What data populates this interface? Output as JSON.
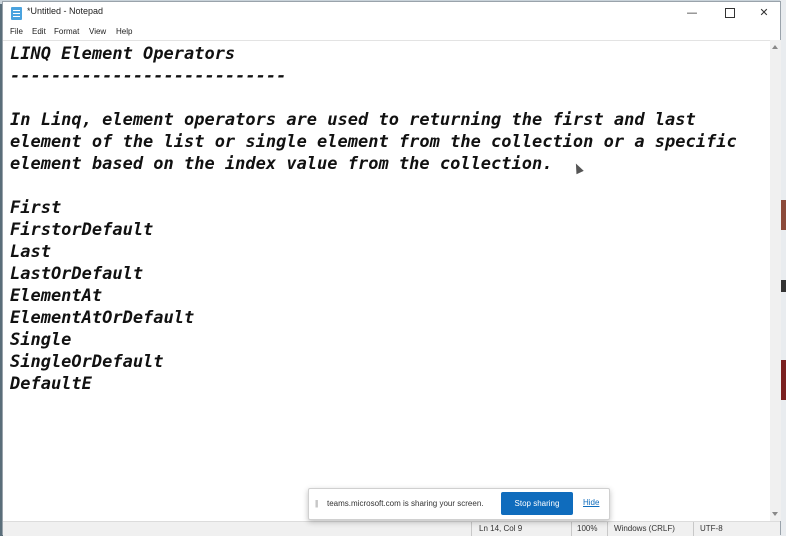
{
  "window": {
    "title": "*Untitled - Notepad",
    "minimize": "—",
    "close": "✕"
  },
  "menu": [
    "File",
    "Edit",
    "Format",
    "View",
    "Help"
  ],
  "document": {
    "lines": [
      "LINQ Element Operators",
      "---------------------------",
      "",
      "In Linq, element operators are used to returning the first and last",
      "element of the list or single element from the collection or a specific",
      "element based on the index value from the collection.",
      "",
      "First",
      "FirstorDefault",
      "Last",
      "LastOrDefault",
      "ElementAt",
      "ElementAtOrDefault",
      "Single",
      "SingleOrDefault",
      "DefaultE"
    ]
  },
  "status": {
    "position": "Ln 14, Col 9",
    "zoom": "100%",
    "line_ending": "Windows (CRLF)",
    "encoding": "UTF-8"
  },
  "share_bar": {
    "message": "teams.microsoft.com is sharing your screen.",
    "stop_label": "Stop sharing",
    "hide_label": "Hide"
  },
  "colors": {
    "accent": "#0f6cbd"
  }
}
